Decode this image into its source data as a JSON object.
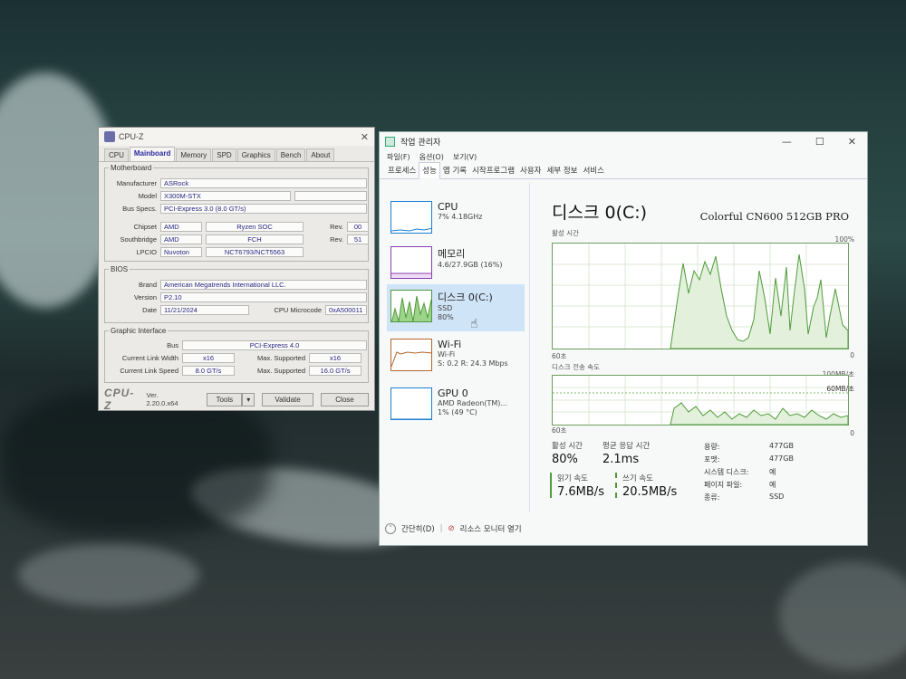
{
  "cpuz": {
    "title": "CPU-Z",
    "tabs": [
      "CPU",
      "Mainboard",
      "Memory",
      "SPD",
      "Graphics",
      "Bench",
      "About"
    ],
    "active_tab": "Mainboard",
    "motherboard": {
      "legend": "Motherboard",
      "manufacturer_label": "Manufacturer",
      "manufacturer": "ASRock",
      "model_label": "Model",
      "model": "X300M-STX",
      "bus_label": "Bus Specs.",
      "bus": "PCI-Express 3.0 (8.0 GT/s)",
      "chipset_label": "Chipset",
      "chipset_vendor": "AMD",
      "chipset_name": "Ryzen SOC",
      "chipset_rev_label": "Rev.",
      "chipset_rev": "00",
      "southbridge_label": "Southbridge",
      "southbridge_vendor": "AMD",
      "southbridge_name": "FCH",
      "southbridge_rev_label": "Rev.",
      "southbridge_rev": "51",
      "lpcio_label": "LPCIO",
      "lpcio_vendor": "Nuvoton",
      "lpcio_name": "NCT6793/NCT5563"
    },
    "bios": {
      "legend": "BIOS",
      "brand_label": "Brand",
      "brand": "American Megatrends International LLC.",
      "version_label": "Version",
      "version": "P2.10",
      "date_label": "Date",
      "date": "11/21/2024",
      "microcode_label": "CPU Microcode",
      "microcode": "0xA500011"
    },
    "graphic_interface": {
      "legend": "Graphic Interface",
      "bus_label": "Bus",
      "bus": "PCI-Express 4.0",
      "link_width_label": "Current Link Width",
      "link_width": "x16",
      "max_supported_label": "Max. Supported",
      "max_width": "x16",
      "link_speed_label": "Current Link Speed",
      "link_speed": "8.0 GT/s",
      "max_speed": "16.0 GT/s"
    },
    "footer": {
      "logo": "CPU-Z",
      "version": "Ver. 2.20.0.x64",
      "tools_label": "Tools",
      "validate_label": "Validate",
      "close_label": "Close"
    }
  },
  "taskmgr": {
    "title": "작업 관리자",
    "menu": [
      "파일(F)",
      "옵션(O)",
      "보기(V)"
    ],
    "tabs": [
      "프로세스",
      "성능",
      "앱 기록",
      "시작프로그램",
      "사용자",
      "세부 정보",
      "서비스"
    ],
    "active_tab": "성능",
    "sidebar": [
      {
        "title": "CPU",
        "sub1": "7% 4.18GHz",
        "sub2": "",
        "sub3": ""
      },
      {
        "title": "메모리",
        "sub1": "4.6/27.9GB (16%)",
        "sub2": "",
        "sub3": ""
      },
      {
        "title": "디스크 0(C:)",
        "sub1": "SSD",
        "sub2": "80%",
        "sub3": ""
      },
      {
        "title": "Wi-Fi",
        "sub1": "Wi-Fi",
        "sub2": "S: 0.2  R: 24.3 Mbps",
        "sub3": ""
      },
      {
        "title": "GPU 0",
        "sub1": "AMD Radeon(TM)...",
        "sub2": "1% (49 °C)",
        "sub3": ""
      }
    ],
    "main": {
      "title": "디스크 0(C:)",
      "model": "Colorful CN600 512GB PRO",
      "active_time_label": "활성 시간",
      "active_max": "100%",
      "sec_label": "60초",
      "zero": "0",
      "transfer_label": "디스크 전송 속도",
      "transfer_max": "100MB/초",
      "transfer_mid": "60MB/초",
      "active_time_stat_label": "활성 시간",
      "active_time_stat": "80%",
      "avg_resp_label": "평균 응답 시간",
      "avg_resp": "2.1ms",
      "read_label": "읽기 속도",
      "read": "7.6MB/s",
      "write_label": "쓰기 속도",
      "write": "20.5MB/s",
      "capacity_label": "용량:",
      "capacity": "477GB",
      "formatted_label": "포맷:",
      "formatted": "477GB",
      "system_disk_label": "시스템 디스크:",
      "system_disk": "예",
      "page_file_label": "페이지 파일:",
      "page_file": "예",
      "type_label": "종류:",
      "type": "SSD"
    },
    "footer": {
      "fewer_label": "간단히(D)",
      "monitor_label": "리소스 모니터 열기"
    },
    "colors": {
      "disk": "#4f9a3a",
      "cpu": "#1c7fd0",
      "memory": "#8a3fb0",
      "wifi": "#b5652a",
      "gpu": "#1c7fd0"
    }
  }
}
